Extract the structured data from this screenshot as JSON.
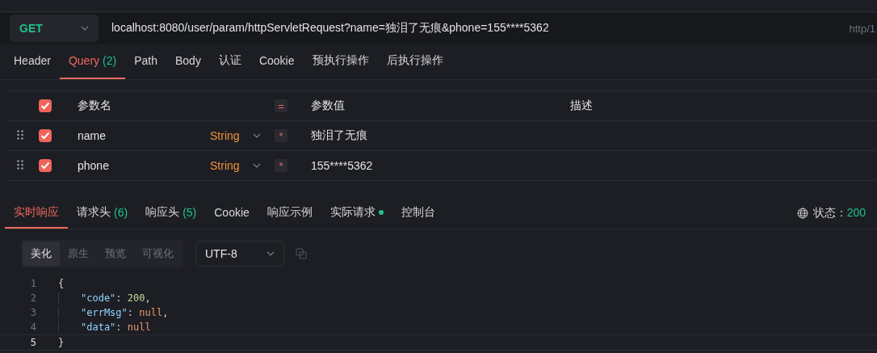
{
  "request": {
    "method": "GET",
    "url": "localhost:8080/user/param/httpServletRequest?name=独泪了无痕&phone=155****5362",
    "protocol": "http/1"
  },
  "request_tabs": [
    {
      "label": "Header",
      "selected": false
    },
    {
      "label": "Query",
      "count": "(2)",
      "selected": true
    },
    {
      "label": "Path",
      "selected": false
    },
    {
      "label": "Body",
      "selected": false
    },
    {
      "label": "认证",
      "selected": false
    },
    {
      "label": "Cookie",
      "selected": false
    },
    {
      "label": "预执行操作",
      "selected": false
    },
    {
      "label": "后执行操作",
      "selected": false
    }
  ],
  "params": {
    "columns": [
      "参数名",
      "参数值",
      "描述"
    ],
    "header_checked": true,
    "header_sign": "=",
    "rows": [
      {
        "checked": true,
        "name": "name",
        "type": "String",
        "required_mark": "*",
        "value": "独泪了无痕"
      },
      {
        "checked": true,
        "name": "phone",
        "type": "String",
        "required_mark": "*",
        "value": "155****5362"
      }
    ]
  },
  "response_tabs": [
    {
      "label": "实时响应",
      "selected": true
    },
    {
      "label": "请求头",
      "count": "(6)",
      "selected": false
    },
    {
      "label": "响应头",
      "count": "(5)",
      "selected": false
    },
    {
      "label": "Cookie",
      "selected": false
    },
    {
      "label": "响应示例",
      "selected": false
    },
    {
      "label": "实际请求",
      "dot": true,
      "selected": false
    },
    {
      "label": "控制台",
      "selected": false
    }
  ],
  "status": {
    "label": "状态：",
    "code": "200"
  },
  "view_modes": [
    {
      "label": "美化",
      "selected": true
    },
    {
      "label": "原生",
      "selected": false
    },
    {
      "label": "预览",
      "selected": false
    },
    {
      "label": "可视化",
      "selected": false
    }
  ],
  "encoding": "UTF-8",
  "code": [
    {
      "number": "1",
      "current": false,
      "tokens": [
        {
          "kind": "punct",
          "text": "{"
        }
      ]
    },
    {
      "number": "2",
      "current": false,
      "tokens": [
        {
          "kind": "key",
          "text": "\"code\""
        },
        {
          "kind": "punct",
          "text": ": "
        },
        {
          "kind": "number",
          "text": "200"
        },
        {
          "kind": "punct",
          "text": ","
        }
      ]
    },
    {
      "number": "3",
      "current": false,
      "tokens": [
        {
          "kind": "key",
          "text": "\"errMsg\""
        },
        {
          "kind": "punct",
          "text": ": "
        },
        {
          "kind": "null",
          "text": "null"
        },
        {
          "kind": "punct",
          "text": ","
        }
      ]
    },
    {
      "number": "4",
      "current": false,
      "tokens": [
        {
          "kind": "key",
          "text": "\"data\""
        },
        {
          "kind": "punct",
          "text": ": "
        },
        {
          "kind": "null",
          "text": "null"
        }
      ]
    },
    {
      "number": "5",
      "current": true,
      "tokens": [
        {
          "kind": "punct",
          "text": "}"
        }
      ]
    }
  ]
}
